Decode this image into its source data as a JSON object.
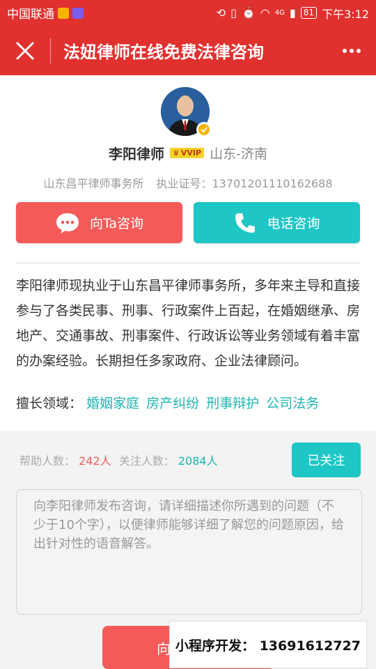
{
  "status_bar": {
    "carrier": "中国联通",
    "network": "4G",
    "battery": "81",
    "time": "下午3:12"
  },
  "navbar": {
    "title": "法妞律师在线免费法律咨询",
    "close_icon": "close-icon",
    "more_icon": "more-dots-icon"
  },
  "profile": {
    "name": "李阳律师",
    "badge": "VVIP",
    "region": "山东-济南",
    "firm": "山东昌平律师事务所",
    "license_label": "执业证号：",
    "license_no": "13701201110162688"
  },
  "actions": {
    "consult_label": "向Ta咨询",
    "phone_label": "电话咨询"
  },
  "intro": "李阳律师现执业于山东昌平律师事务所，多年来主导和直接参与了各类民事、刑事、行政案件上百起，在婚姻继承、房地产、交通事故、刑事案件、行政诉讼等业务领域有着丰富的办案经验。长期担任多家政府、企业法律顾问。",
  "specialty": {
    "label": "擅长领域：",
    "tags": [
      "婚姻家庭",
      "房产纠纷",
      "刑事辩护",
      "公司法务"
    ]
  },
  "stats": {
    "help_label": "帮助人数：",
    "help_value": "242人",
    "follow_label": "关注人数：",
    "follow_value": "2084人",
    "follow_button": "已关注"
  },
  "question": {
    "placeholder": "向李阳律师发布咨询，请详细描述你所遇到的问题（不少于10个字），以便律师能够详细了解您的问题原因，给出针对性的语音解答。"
  },
  "submit_label": "向",
  "watermark": "小程序开发：  13691612727",
  "colors": {
    "brand_red": "#e0312f",
    "consult_red": "#f45a5a",
    "teal": "#1ec6c6"
  }
}
